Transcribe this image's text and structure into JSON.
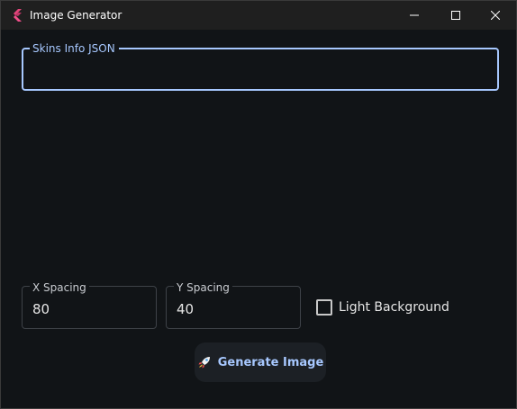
{
  "window": {
    "title": "Image Generator",
    "controls": {
      "minimize": "minimize-icon",
      "maximize": "maximize-icon",
      "close": "close-icon"
    },
    "app_icon": "flutter-logo-icon"
  },
  "form": {
    "skins_json": {
      "label": "Skins Info JSON",
      "value": ""
    },
    "x_spacing": {
      "label": "X Spacing",
      "value": "80"
    },
    "y_spacing": {
      "label": "Y Spacing",
      "value": "40"
    },
    "light_background": {
      "label": "Light Background",
      "checked": false
    },
    "generate_button": {
      "label": "Generate Image",
      "icon": "rocket-icon"
    }
  },
  "colors": {
    "accent": "#a7c8ff",
    "background": "#111417",
    "titlebar": "#1f1f1f",
    "button_bg": "#1c2025"
  }
}
